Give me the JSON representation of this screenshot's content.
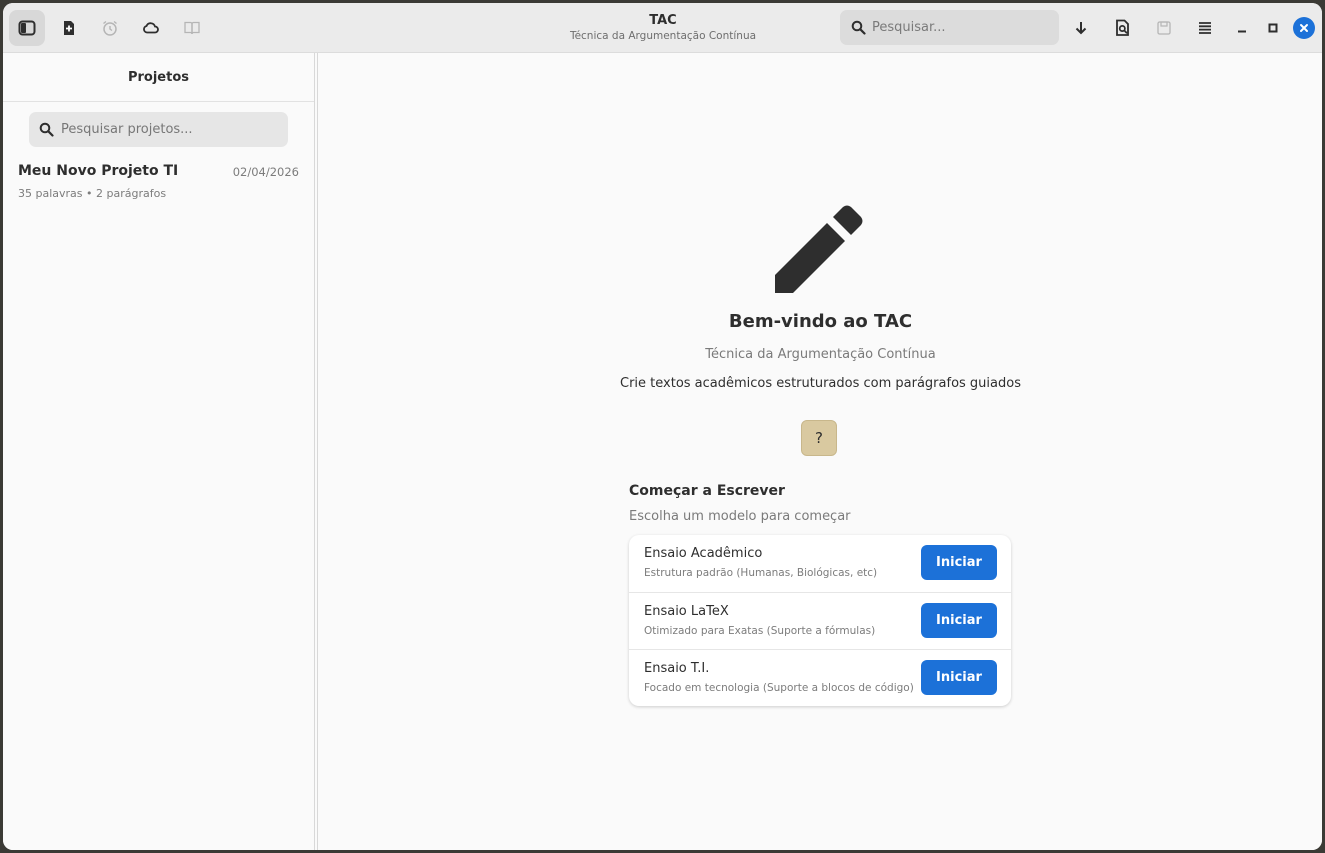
{
  "app": {
    "title": "TAC",
    "subtitle": "Técnica da Argumentação Contínua"
  },
  "header": {
    "left_icons": [
      "sidebar-toggle-icon",
      "new-document-icon",
      "alarm-icon",
      "cloud-icon",
      "book-icon"
    ],
    "search_placeholder": "Pesquisar...",
    "right_icons": [
      "download-icon",
      "document-search-icon",
      "save-icon",
      "menu-icon"
    ],
    "window_controls": [
      "minimize-icon",
      "maximize-icon",
      "close-icon"
    ]
  },
  "sidebar": {
    "title": "Projetos",
    "search_placeholder": "Pesquisar projetos...",
    "projects": [
      {
        "name": "Meu Novo Projeto TI",
        "date": "02/04/2026",
        "meta": "35 palavras • 2 parágrafos"
      }
    ]
  },
  "main": {
    "icon": "pencil-icon",
    "welcome": "Bem-vindo ao TAC",
    "tagline": "Técnica da Argumentação Contínua",
    "description": "Crie textos acadêmicos estruturados com parágrafos guiados",
    "help_label": "?",
    "start_title": "Começar a Escrever",
    "start_subtitle": "Escolha um modelo para começar",
    "templates": [
      {
        "name": "Ensaio Acadêmico",
        "desc": "Estrutura padrão (Humanas, Biológicas, etc)",
        "button": "Iniciar"
      },
      {
        "name": "Ensaio LaTeX",
        "desc": "Otimizado para Exatas (Suporte a fórmulas)",
        "button": "Iniciar"
      },
      {
        "name": "Ensaio T.I.",
        "desc": "Focado em tecnologia (Suporte a blocos de código)",
        "button": "Iniciar"
      }
    ]
  },
  "colors": {
    "accent": "#1c71d8",
    "help_button": "#d9c9a0"
  }
}
